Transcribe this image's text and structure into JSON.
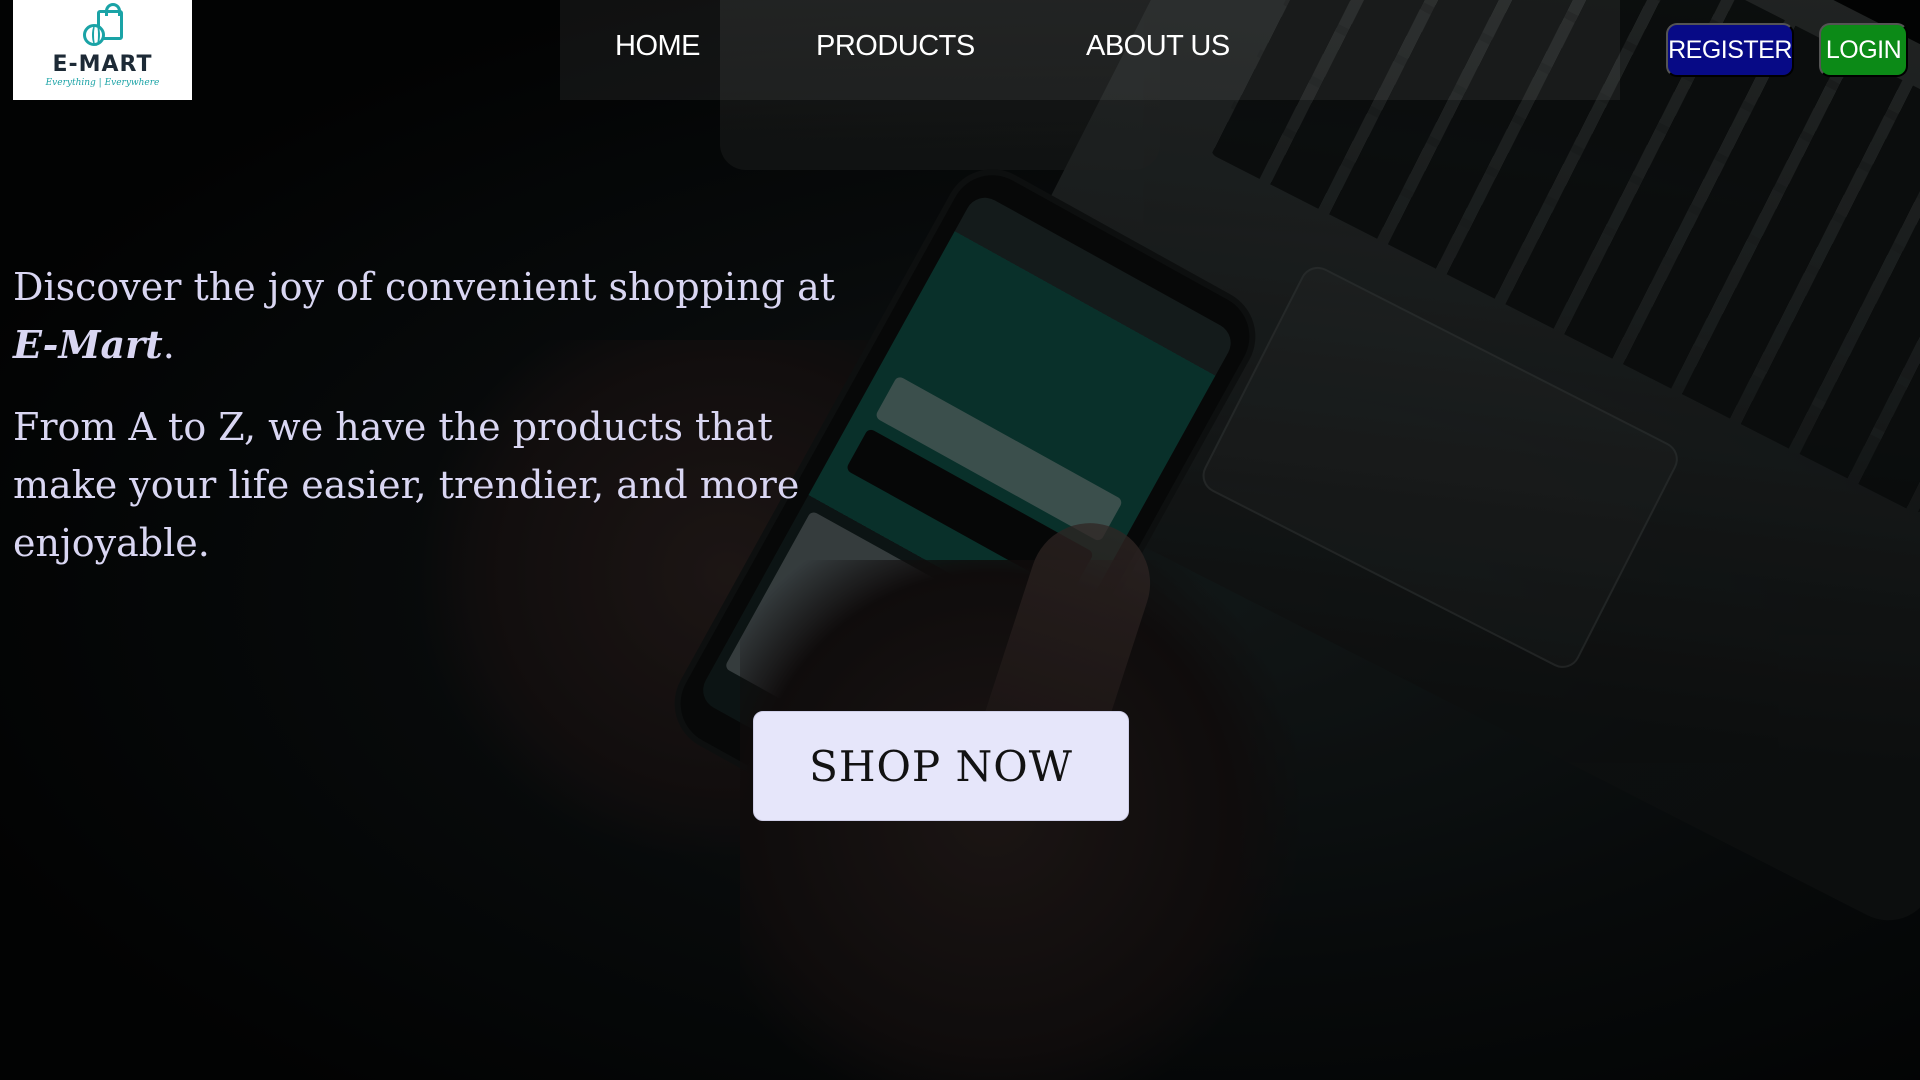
{
  "brand": {
    "name": "E-MART",
    "tagline": "Everything | Everywhere"
  },
  "nav": {
    "items": [
      {
        "label": "HOME"
      },
      {
        "label": "PRODUCTS"
      },
      {
        "label": "ABOUT US"
      }
    ]
  },
  "auth": {
    "register_label": "REGISTER",
    "login_label": "LOGIN"
  },
  "hero": {
    "line1": "Discover the joy of convenient shopping at ",
    "brand": "E-Mart",
    "line1_end": ".",
    "paragraph2": "From A to Z, we have the products that make your life easier, trendier, and more enjoyable.",
    "cta_label": "SHOP NOW"
  },
  "colors": {
    "register_bg": "#070a86",
    "login_bg": "#0c8a17",
    "cta_bg": "#e6e6fa",
    "hero_text": "#d9d6f2",
    "logo_accent": "#1aa3a6"
  },
  "icons": {
    "logo": "shopping-bag-globe-icon"
  }
}
